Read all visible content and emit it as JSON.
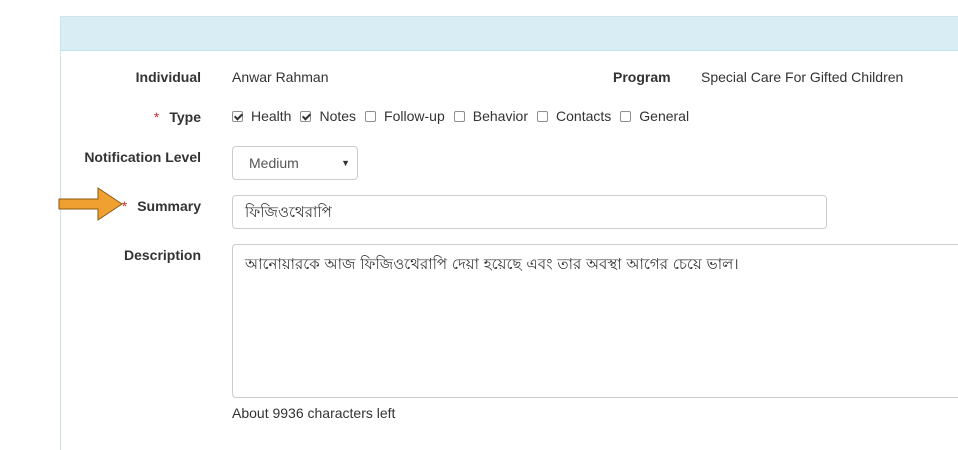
{
  "form": {
    "individual": {
      "label": "Individual",
      "value": "Anwar Rahman"
    },
    "program": {
      "label": "Program",
      "value": "Special Care For Gifted Children"
    },
    "type": {
      "required_mark": "*",
      "label": "Type",
      "options": [
        {
          "label": "Health",
          "checked": true
        },
        {
          "label": "Notes",
          "checked": true
        },
        {
          "label": "Follow-up",
          "checked": false
        },
        {
          "label": "Behavior",
          "checked": false
        },
        {
          "label": "Contacts",
          "checked": false
        },
        {
          "label": "General",
          "checked": false
        }
      ]
    },
    "notification_level": {
      "label": "Notification Level",
      "selected": "Medium"
    },
    "summary": {
      "required_mark": "*",
      "label": "Summary",
      "value": "ফিজিওথেরাপি"
    },
    "description": {
      "label": "Description",
      "value": "আনোয়ারকে আজ ফিজিওথেরাপি দেয়া হয়েছে এবং তার অবস্থা আগের চেয়ে ভাল।",
      "chars_left": "About 9936 characters left"
    }
  },
  "annotation": {
    "arrow_color": "#f0a030"
  },
  "colors": {
    "header_bg": "#d9edf4",
    "required": "#c9302c"
  }
}
